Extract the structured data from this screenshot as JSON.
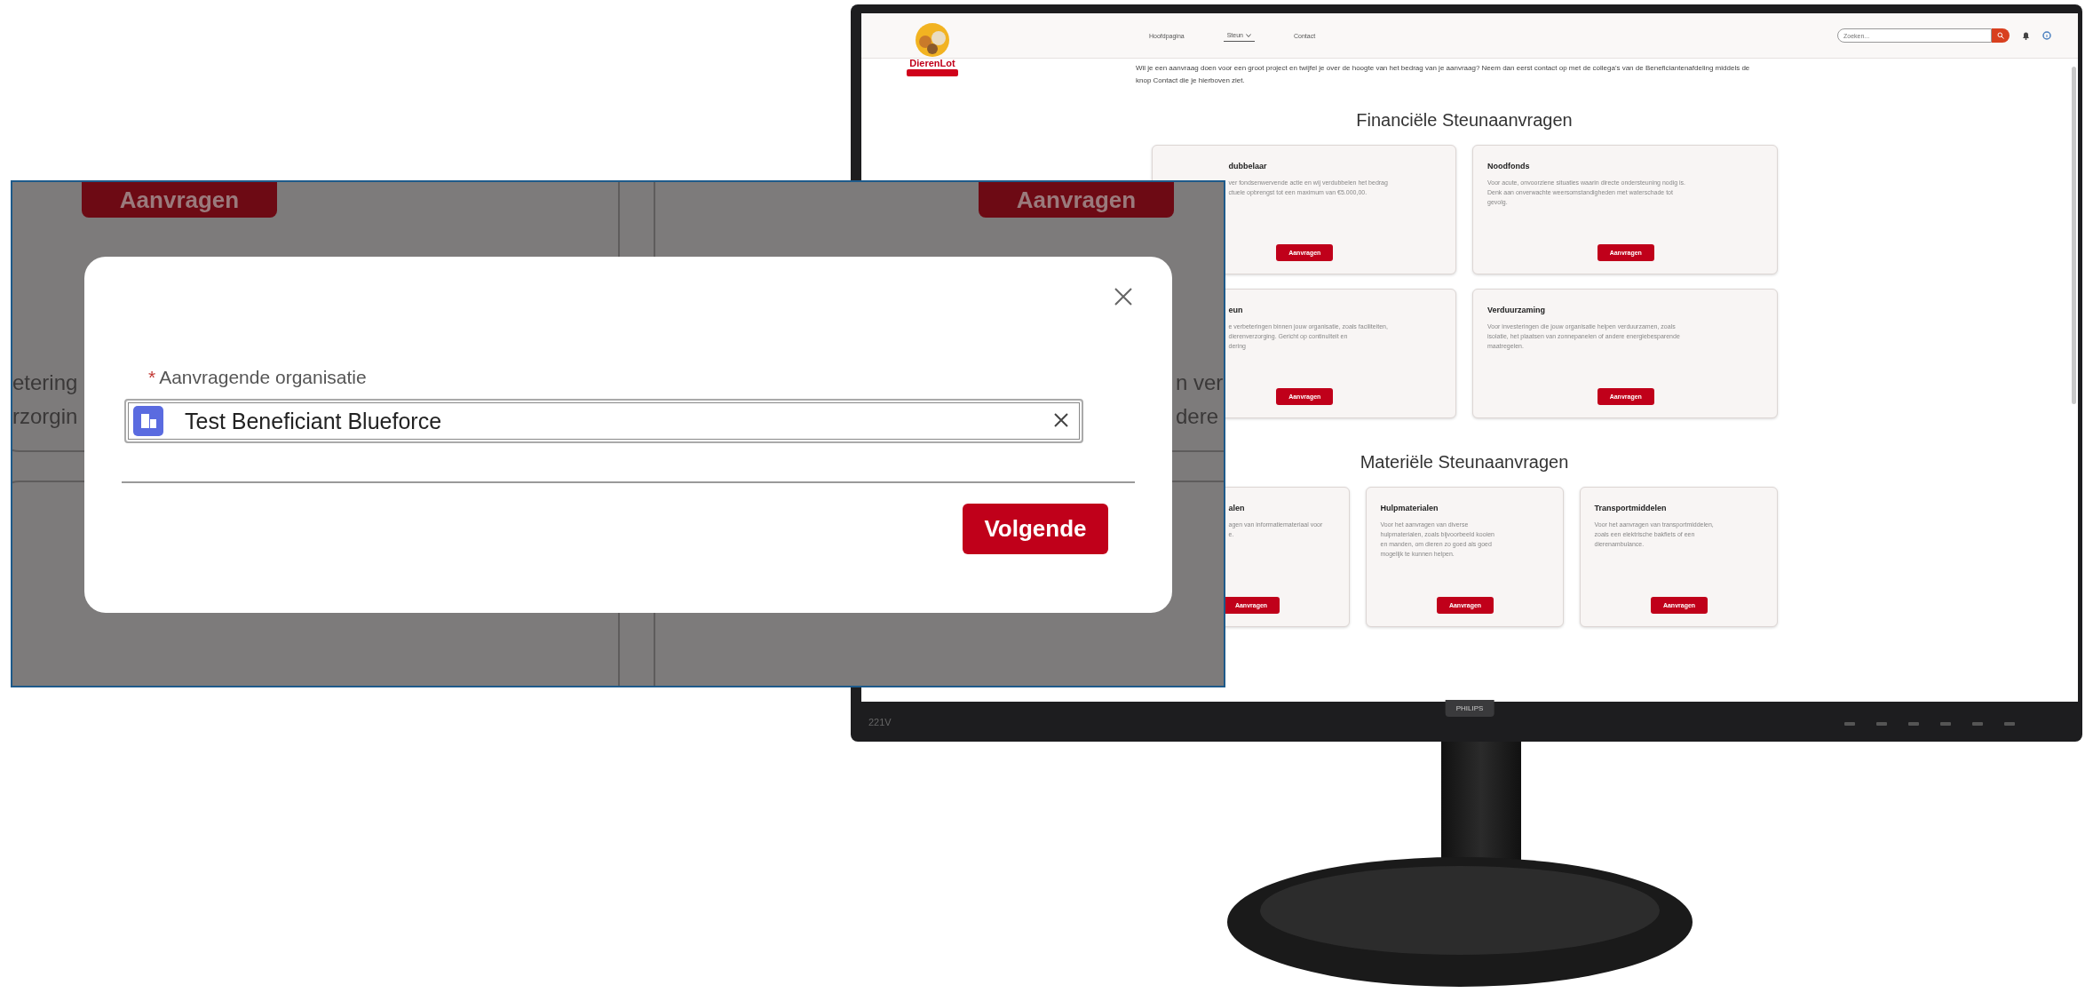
{
  "monitor": {
    "model": "221V",
    "brand": "PHILIPS"
  },
  "site": {
    "logo_text": "DierenLot",
    "nav": [
      {
        "label": "Hoofdpagina",
        "selected": false,
        "dropdown": false
      },
      {
        "label": "Steun",
        "selected": true,
        "dropdown": true
      },
      {
        "label": "Contact",
        "selected": false,
        "dropdown": false
      }
    ],
    "search": {
      "placeholder": "Zoeken..."
    },
    "intro": "Wil je een aanvraag doen voor een groot project en twijfel je over de hoogte van het bedrag van je aanvraag? Neem dan eerst contact op met de collega's van de Beneficiantenafdeling middels de knop Contact die je hierboven ziet.",
    "sections": [
      {
        "title": "Financiële Steunaanvragen",
        "cards": [
          {
            "title": "dubbelaar",
            "lines": [
              "ver fondsenwervende actie en wij verdubbelen het bedrag",
              "ctuele opbrengst tot een maximum van €5.000,00."
            ],
            "button": "Aanvragen",
            "partial": true
          },
          {
            "title": "Noodfonds",
            "lines": [
              "Voor acute, onvoorziene situaties waarin directe ondersteuning nodig is.",
              "Denk aan onverwachte weersomstandigheden met waterschade tot",
              "gevolg."
            ],
            "button": "Aanvragen",
            "partial": false
          },
          {
            "title": "eun",
            "lines": [
              "e verbeteringen binnen jouw organisatie, zoals faciliteiten,",
              "dierenverzorging. Gericht op continuïteit en",
              "dering"
            ],
            "button": "Aanvragen",
            "partial": true
          },
          {
            "title": "Verduurzaming",
            "lines": [
              "Voor investeringen die jouw organisatie helpen verduurzamen, zoals",
              "isolatie, het plaatsen van zonnepanelen of andere energiebesparende",
              "maatregelen."
            ],
            "button": "Aanvragen",
            "partial": false
          }
        ]
      },
      {
        "title": "Materiële Steunaanvragen",
        "cards": [
          {
            "title": "alen",
            "lines": [
              "agen van informatiemateriaal voor",
              "e."
            ],
            "button": "Aanvragen",
            "partial": true
          },
          {
            "title": "Hulpmaterialen",
            "lines": [
              "Voor het aanvragen van diverse",
              "hulpmaterialen, zoals bijvoorbeeld kooien",
              "en manden, om dieren zo goed als goed",
              "mogelijk te kunnen helpen."
            ],
            "button": "Aanvragen",
            "partial": false
          },
          {
            "title": "Transportmiddelen",
            "lines": [
              "Voor het aanvragen van transportmiddelen,",
              "zoals een elektrische bakfiets of een",
              "dierenambulance."
            ],
            "button": "Aanvragen",
            "partial": false
          }
        ]
      }
    ]
  },
  "inset": {
    "background": {
      "buttons": [
        "Aanvragen",
        "Aanvragen"
      ],
      "left_fragments": [
        "etering",
        "rzorgin"
      ],
      "right_fragments": [
        "n ver",
        "dere"
      ]
    },
    "modal": {
      "required_mark": "*",
      "label": "Aanvragende organisatie",
      "value": "Test Beneficiant Blueforce",
      "button": "Volgende"
    }
  }
}
